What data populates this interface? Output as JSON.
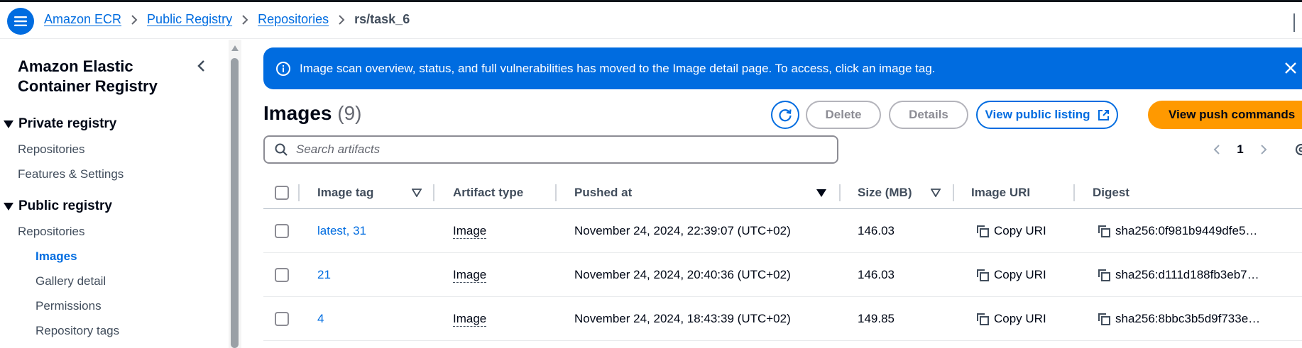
{
  "breadcrumb": {
    "items": [
      "Amazon ECR",
      "Public Registry",
      "Repositories"
    ],
    "current": "rs/task_6"
  },
  "sidebar": {
    "title": "Amazon Elastic Container Registry",
    "sections": [
      {
        "label": "Private registry",
        "items": [
          "Repositories",
          "Features & Settings"
        ]
      },
      {
        "label": "Public registry",
        "items": [
          "Repositories"
        ]
      }
    ],
    "subitems": [
      "Images",
      "Gallery detail",
      "Permissions",
      "Repository tags"
    ],
    "active_item": "Images"
  },
  "flash": {
    "message": "Image scan overview, status, and full vulnerabilities has moved to the Image detail page. To access, click an image tag."
  },
  "header": {
    "title": "Images",
    "count": "(9)",
    "buttons": {
      "delete": "Delete",
      "details": "Details",
      "view_public_listing": "View public listing",
      "view_push_commands": "View push commands"
    }
  },
  "search": {
    "placeholder": "Search artifacts"
  },
  "pagination": {
    "current_page": "1"
  },
  "table": {
    "columns": [
      "Image tag",
      "Artifact type",
      "Pushed at",
      "Size (MB)",
      "Image URI",
      "Digest"
    ],
    "rows": [
      {
        "tag": "latest, 31",
        "type": "Image",
        "pushed": "November 24, 2024, 22:39:07 (UTC+02)",
        "size": "146.03",
        "uri": "Copy URI",
        "digest": "sha256:0f981b9449dfe5…"
      },
      {
        "tag": "21",
        "type": "Image",
        "pushed": "November 24, 2024, 20:40:36 (UTC+02)",
        "size": "146.03",
        "uri": "Copy URI",
        "digest": "sha256:d111d188fb3eb7…"
      },
      {
        "tag": "4",
        "type": "Image",
        "pushed": "November 24, 2024, 18:43:39 (UTC+02)",
        "size": "149.85",
        "uri": "Copy URI",
        "digest": "sha256:8bbc3b5d9f733e…"
      }
    ]
  },
  "colors": {
    "accent": "#006ce0",
    "push_button": "#ff9900",
    "text": "#000716"
  }
}
